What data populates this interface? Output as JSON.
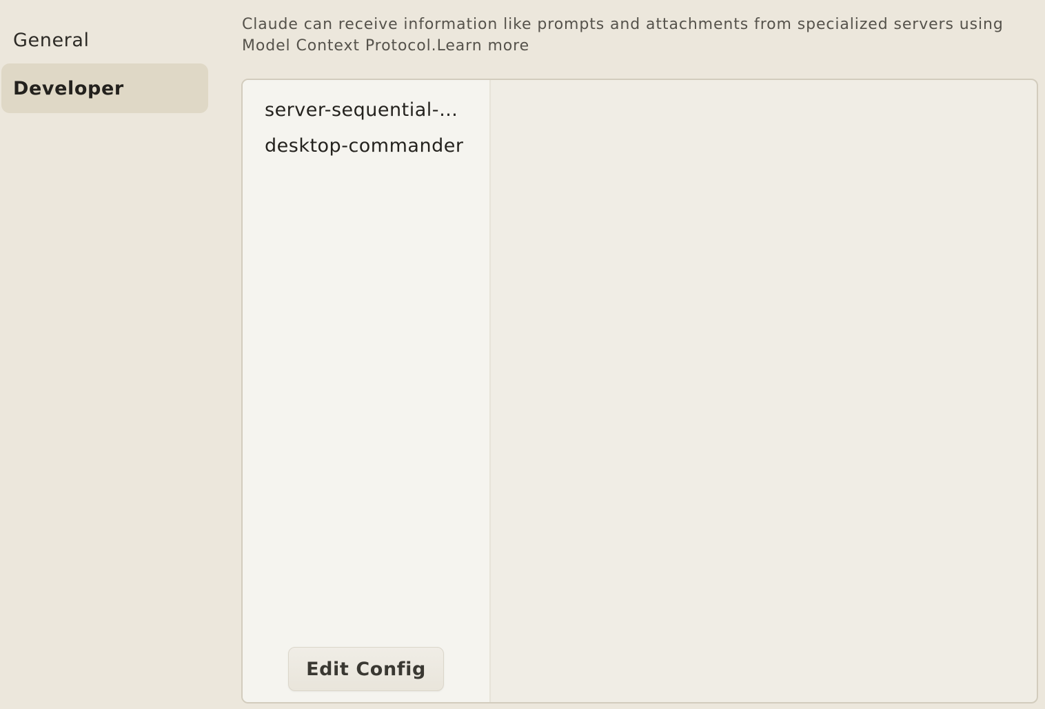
{
  "sidebar": {
    "items": [
      {
        "label": "General",
        "selected": false
      },
      {
        "label": "Developer",
        "selected": true
      }
    ]
  },
  "description": {
    "text": "Claude can receive information like prompts and attachments from specialized servers using Model Context Protocol.",
    "learn_more": "Learn more"
  },
  "servers": {
    "items": [
      {
        "label": "server-sequential-thinking"
      },
      {
        "label": "desktop-commander"
      }
    ],
    "edit_config_label": "Edit Config"
  }
}
